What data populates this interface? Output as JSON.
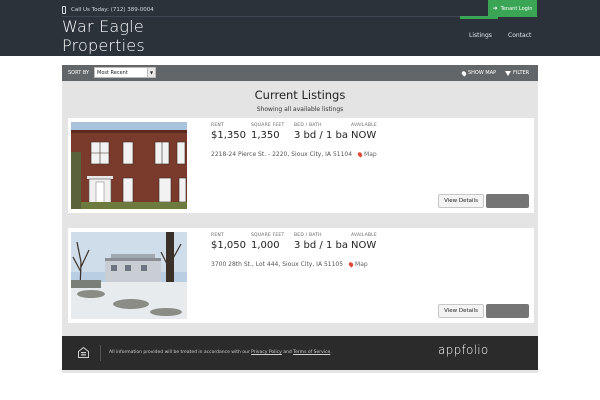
{
  "header": {
    "phone_text": "Call Us Today: (712) 389-0004",
    "logo_line1": "War Eagle",
    "logo_line2": "Properties",
    "tenant_login": "Tenant Login",
    "nav": [
      {
        "label": "Listings",
        "active": true
      },
      {
        "label": "Contact",
        "active": false
      }
    ],
    "colors": {
      "bar": "#2b323a",
      "accent": "#3aa655"
    }
  },
  "toolbar": {
    "sort_label": "SORT BY",
    "sort_value": "Most Recent",
    "show_map": "SHOW MAP",
    "filter": "FILTER"
  },
  "listings_header": {
    "title": "Current Listings",
    "subtitle": "Showing all available listings"
  },
  "attribute_labels": {
    "rent": "RENT",
    "square_feet": "SQUARE FEET",
    "bed_bath": "BED / BATH",
    "available": "AVAILABLE"
  },
  "listings": [
    {
      "rent": "$1,350",
      "square_feet": "1,350",
      "bed_bath": "3 bd / 1 ba",
      "available": "NOW",
      "address": "2218-24 Pierce St. - 2220, Sioux City, IA 51104",
      "map_label": "Map",
      "details_label": "View Details"
    },
    {
      "rent": "$1,050",
      "square_feet": "1,000",
      "bed_bath": "3 bd / 1 ba",
      "available": "NOW",
      "address": "3700 28th St., Lot 444, Sioux City, IA 51105",
      "map_label": "Map",
      "details_label": "View Details"
    }
  ],
  "footer": {
    "text_before": "All information provided will be treated in accordance with our ",
    "privacy_link": "Privacy Policy",
    "text_and": " and ",
    "terms_link": "Terms of Service",
    "text_end": ".",
    "brand": "appfolio"
  }
}
